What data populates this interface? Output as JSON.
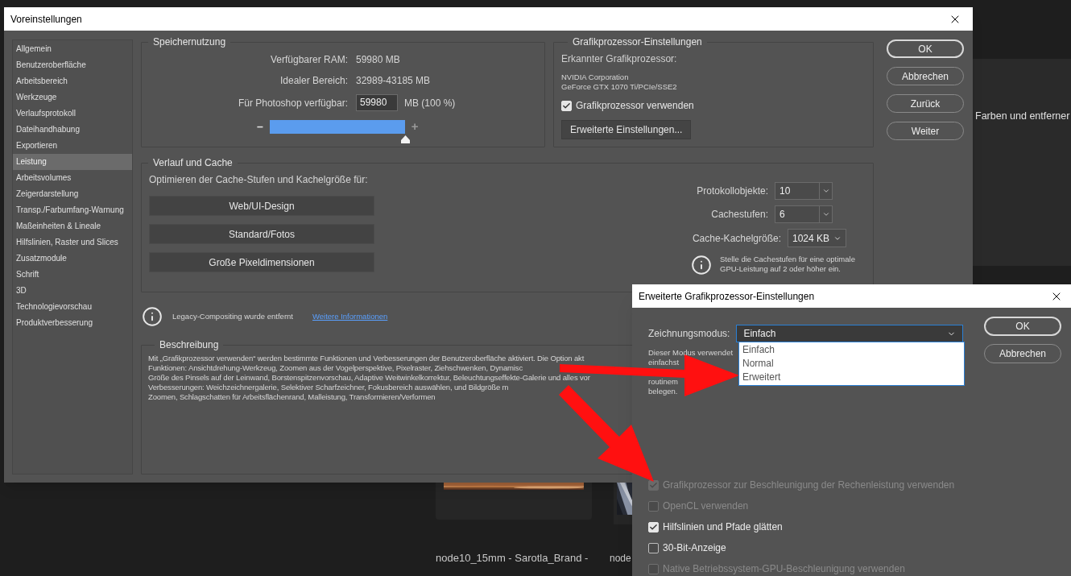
{
  "background": {
    "panel_text": "Farben und entferner",
    "files": [
      {
        "name": "node10_15mm - Sarotla_Brand -"
      },
      {
        "name": "node"
      }
    ]
  },
  "main_dialog": {
    "title": "Voreinstellungen",
    "sidebar": {
      "items": [
        {
          "label": "Allgemein",
          "selected": false
        },
        {
          "label": "Benutzeroberfläche",
          "selected": false
        },
        {
          "label": "Arbeitsbereich",
          "selected": false
        },
        {
          "label": "Werkzeuge",
          "selected": false
        },
        {
          "label": "Verlaufsprotokoll",
          "selected": false
        },
        {
          "label": "Dateihandhabung",
          "selected": false
        },
        {
          "label": "Exportieren",
          "selected": false
        },
        {
          "label": "Leistung",
          "selected": true
        },
        {
          "label": "Arbeitsvolumes",
          "selected": false
        },
        {
          "label": "Zeigerdarstellung",
          "selected": false
        },
        {
          "label": "Transp./Farbumfang-Warnung",
          "selected": false
        },
        {
          "label": "Maßeinheiten & Lineale",
          "selected": false
        },
        {
          "label": "Hilfslinien, Raster und Slices",
          "selected": false
        },
        {
          "label": "Zusatzmodule",
          "selected": false
        },
        {
          "label": "Schrift",
          "selected": false
        },
        {
          "label": "3D",
          "selected": false
        },
        {
          "label": "Technologievorschau",
          "selected": false
        },
        {
          "label": "Produktverbesserung",
          "selected": false
        }
      ]
    },
    "memory": {
      "title": "Speichernutzung",
      "ram_label": "Verfügbarer RAM:",
      "ram_value": "59980 MB",
      "range_label": "Idealer Bereich:",
      "range_value": "32989-43185 MB",
      "available_label": "Für Photoshop verfügbar:",
      "available_value": "59980",
      "available_unit": "MB (100 %)",
      "minus": "–",
      "plus": "+",
      "level": 1.0
    },
    "gpu": {
      "title": "Grafikprozessor-Einstellungen",
      "detected_label": "Erkannter Grafikprozessor:",
      "vendor": "NVIDIA Corporation",
      "model": "GeForce GTX 1070 Ti/PCIe/SSE2",
      "use_gpu": {
        "label": "Grafikprozessor verwenden",
        "checked": true
      },
      "advanced_button": "Erweiterte Einstellungen..."
    },
    "buttons": [
      "OK",
      "Abbrechen",
      "Zurück",
      "Weiter"
    ],
    "cache": {
      "title": "Verlauf und Cache",
      "optimize_label": "Optimieren der Cache-Stufen und Kachelgröße für:",
      "presets": [
        "Web/UI-Design",
        "Standard/Fotos",
        "Große Pixeldimensionen"
      ],
      "settings": [
        {
          "label": "Protokollobjekte:",
          "value": "10",
          "kind": "spin"
        },
        {
          "label": "Cachestufen:",
          "value": "6",
          "kind": "spin"
        },
        {
          "label": "Cache-Kachelgröße:",
          "value": "1024 KB",
          "kind": "combo"
        }
      ],
      "hint": "Stelle die Cachestufen für eine optimale GPU-Leistung auf 2 oder höher ein."
    },
    "notice": {
      "text": "Legacy-Compositing wurde entfernt",
      "link": "Weitere Informationen"
    },
    "description": {
      "title": "Beschreibung",
      "lines": [
        "Mit „Grafikprozessor verwenden“ werden bestimmte Funktionen und Verbesserungen der Benutzeroberfläche aktiviert. Die Option akt",
        "Funktionen: Ansichtdrehung-Werkzeug, Zoomen aus der Vogelperspektive, Pixelraster, Ziehschwenken, Dynamisc",
        "Größe des Pinsels auf der Leinwand, Borstenspitzenvorschau, Adaptive Weitwinkelkorrektur, Beleuchtungseffekte-Galerie und alles vor",
        "Verbesserungen: Weichzeichnergalerie, Selektiver Scharfzeichner, Fokusbereich auswählen, und Bildgröße m",
        "Zoomen, Schlagschatten für Arbeitsflächenrand, Malleistung, Transformieren/Verformen"
      ]
    }
  },
  "advanced_dialog": {
    "title": "Erweiterte Grafikprozessor-Einstellungen",
    "mode_label": "Zeichnungsmodus:",
    "mode_value": "Einfach",
    "options": [
      "Einfach",
      "Normal",
      "Erweitert"
    ],
    "description_lines": [
      "Dieser Modus verwendet",
      "einfachst",
      "routinem",
      "belegen."
    ],
    "buttons": [
      "OK",
      "Abbrechen"
    ],
    "checks": [
      {
        "label": "Grafikprozessor zur Beschleunigung der Rechenleistung verwenden",
        "checked": true,
        "disabled": true
      },
      {
        "label": "OpenCL verwenden",
        "checked": false,
        "disabled": true
      },
      {
        "label": "Hilfslinien und Pfade glätten",
        "checked": true,
        "disabled": false
      },
      {
        "label": "30-Bit-Anzeige",
        "checked": false,
        "disabled": false
      },
      {
        "label": "Native Betriebssystem-GPU-Beschleunigung verwenden",
        "checked": false,
        "disabled": true
      }
    ]
  }
}
